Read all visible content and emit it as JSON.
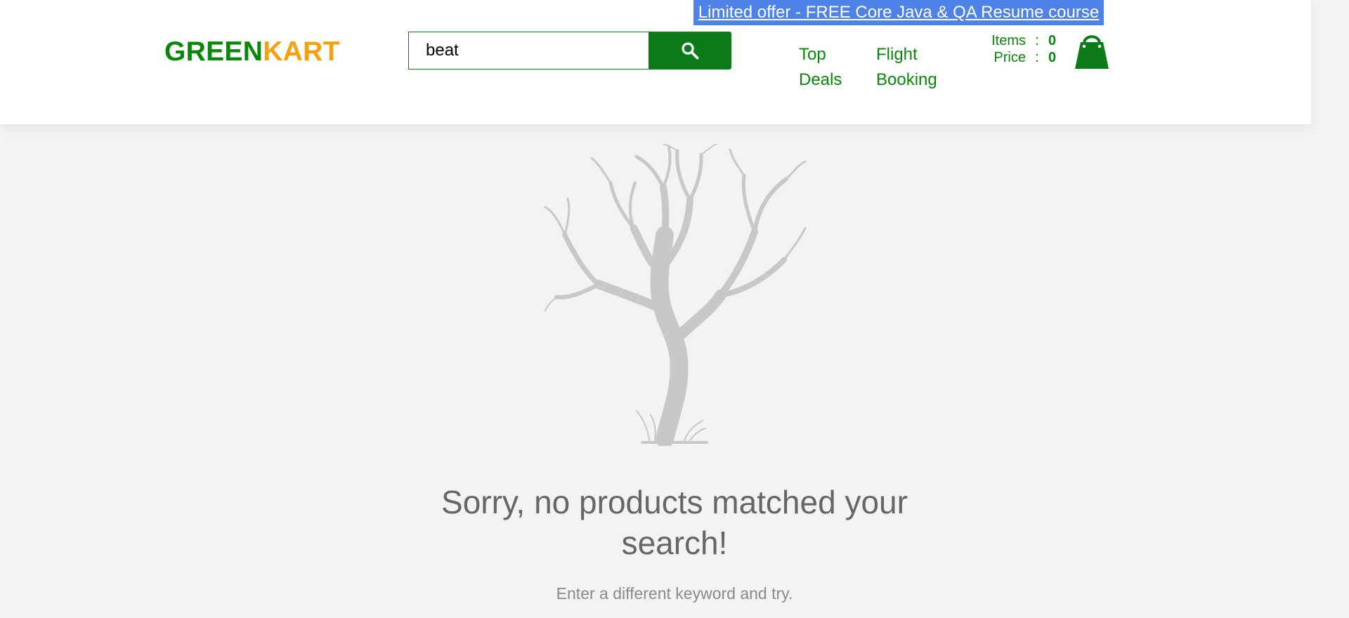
{
  "promo": {
    "text": "Limited offer - FREE Core Java & QA Resume course"
  },
  "logo": {
    "part1": "GREEN",
    "part2": "KART"
  },
  "search": {
    "value": "beat"
  },
  "nav": {
    "top_deals": {
      "line1": "Top",
      "line2": "Deals"
    },
    "flight_booking": {
      "line1": "Flight",
      "line2": "Booking"
    }
  },
  "cart": {
    "items_label": "Items",
    "items_value": "0",
    "price_label": "Price",
    "price_value": "0",
    "separator": ":"
  },
  "empty_state": {
    "title": "Sorry, no products matched your search!",
    "hint": "Enter a different keyword and try."
  },
  "icons": {
    "search": "search-icon",
    "cart": "shopping-bag-icon",
    "illustration": "bare-tree-illustration"
  },
  "colors": {
    "brand_green": "#0a860a",
    "brand_orange": "#f3a10e",
    "promo_blue": "#4f82e6",
    "search_button": "#0a7b18"
  }
}
